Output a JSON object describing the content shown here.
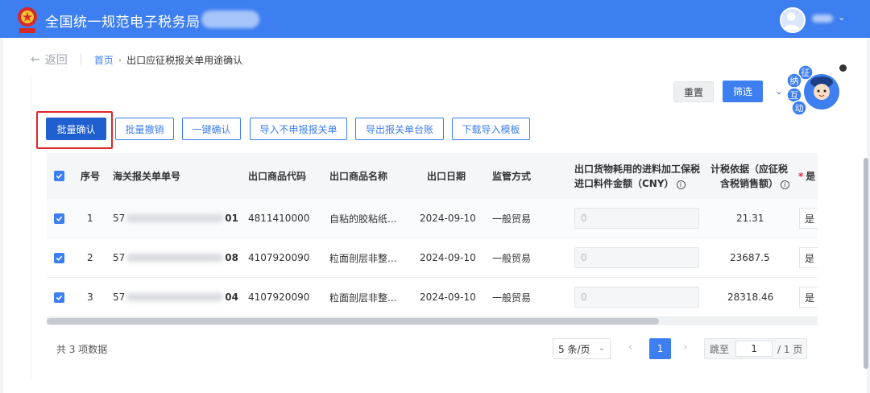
{
  "app": {
    "title": "全国统一规范电子税务局",
    "colors": {
      "primary": "#3d7ef0",
      "danger": "#e0242b"
    }
  },
  "nav": {
    "back_label": "返回",
    "breadcrumb": {
      "home": "首页",
      "current": "出口应征税报关单用途确认"
    }
  },
  "filters": {
    "reset_label": "重置",
    "filter_label": "筛选"
  },
  "mascot": {
    "line1": "征",
    "line2": "纳",
    "line3": "互",
    "line4": "动"
  },
  "toolbar": {
    "batch_confirm": "批量确认",
    "batch_revoke": "批量撤销",
    "one_click_confirm": "一键确认",
    "import_undeclared": "导入不申报报关单",
    "export_ledger": "导出报关单台账",
    "download_template": "下载导入模板"
  },
  "table": {
    "headers": {
      "seq": "序号",
      "customs_no": "海关报关单单号",
      "goods_code": "出口商品代码",
      "goods_name": "出口商品名称",
      "export_date": "出口日期",
      "supervision": "监管方式",
      "material_amount_l1": "出口货物耗用的进料加工保税",
      "material_amount_l2": "进口料件金额（CNY）",
      "tax_basis_l1": "计税依据（应征税",
      "tax_basis_l2": "含税销售额）",
      "is_col": "是"
    },
    "rows": [
      {
        "seq": "1",
        "customs_prefix": "57",
        "customs_suffix": "01",
        "goods_code": "4811410000",
        "goods_name": "自粘的胶粘纸...",
        "export_date": "2024-09-10",
        "supervision": "一般贸易",
        "material_amount": "0",
        "tax_basis": "21.31",
        "is": "是"
      },
      {
        "seq": "2",
        "customs_prefix": "57",
        "customs_suffix": "08",
        "goods_code": "4107920090",
        "goods_name": "粒面剖层非整...",
        "export_date": "2024-09-10",
        "supervision": "一般贸易",
        "material_amount": "0",
        "tax_basis": "23687.5",
        "is": "是"
      },
      {
        "seq": "3",
        "customs_prefix": "57",
        "customs_suffix": "04",
        "goods_code": "4107920090",
        "goods_name": "粒面剖层非整...",
        "export_date": "2024-09-10",
        "supervision": "一般贸易",
        "material_amount": "0",
        "tax_basis": "28318.46",
        "is": "是"
      }
    ]
  },
  "pagination": {
    "total_label": "共 3 项数据",
    "page_size": "5 条/页",
    "current_page": "1",
    "jump_label": "跳至",
    "jump_value": "1",
    "total_pages": "/ 1 页"
  }
}
